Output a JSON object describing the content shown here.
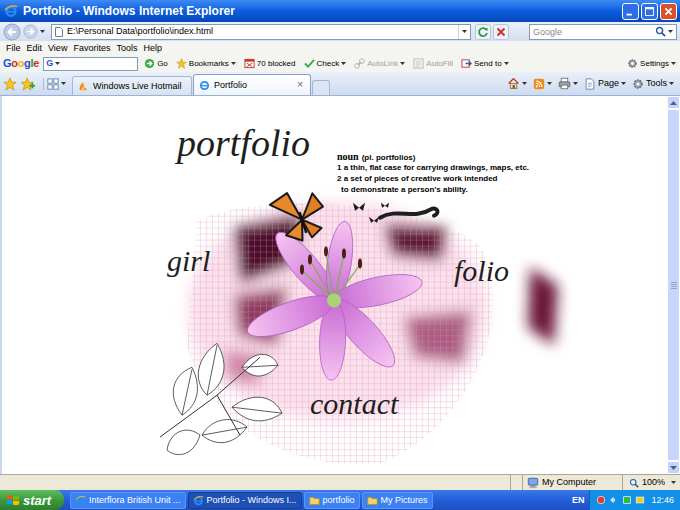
{
  "window": {
    "title": "Portfolio - Windows Internet Explorer"
  },
  "address_bar": {
    "url": "E:\\Personal Data\\portfolio\\index.html"
  },
  "search": {
    "placeholder": "Google"
  },
  "menu": [
    "File",
    "Edit",
    "View",
    "Favorites",
    "Tools",
    "Help"
  ],
  "google_toolbar": {
    "logo": "Google",
    "field_label": "G",
    "items": [
      {
        "label": "Go",
        "disabled": false,
        "dropdown": false
      },
      {
        "label": "Bookmarks",
        "disabled": false,
        "dropdown": true
      },
      {
        "label": "70 blocked",
        "disabled": false,
        "dropdown": false
      },
      {
        "label": "Check",
        "disabled": false,
        "dropdown": true
      },
      {
        "label": "AutoLink",
        "disabled": true,
        "dropdown": true
      },
      {
        "label": "AutoFill",
        "disabled": true,
        "dropdown": false
      },
      {
        "label": "Send to",
        "disabled": false,
        "dropdown": true
      }
    ],
    "settings": "Settings"
  },
  "tabs": [
    {
      "label": "Windows Live Hotmail",
      "selected": false
    },
    {
      "label": "Portfolio",
      "selected": true
    }
  ],
  "tab_close": "×",
  "command_bar": [
    "Page",
    "Tools"
  ],
  "page": {
    "title": "portfolio",
    "definition": {
      "headword": "noun",
      "note": "(pl. portfolios)",
      "senses": [
        "1 a thin, flat case for carrying drawings, maps, etc.",
        "2 a set of pieces of creative work intended",
        "to demonstrate a person's ability."
      ]
    },
    "links": [
      "girl",
      "folio",
      "contact"
    ]
  },
  "status_bar": {
    "zone": "My Computer",
    "zoom": "100%"
  },
  "taskbar": {
    "start": "start",
    "tasks": [
      {
        "label": "Interflora British Unit ...",
        "selected": false
      },
      {
        "label": "Portfolio - Windows I...",
        "selected": true
      },
      {
        "label": "portfolio",
        "selected": false
      },
      {
        "label": "My Pictures",
        "selected": false
      }
    ],
    "language": "EN",
    "clock": "12:46"
  }
}
